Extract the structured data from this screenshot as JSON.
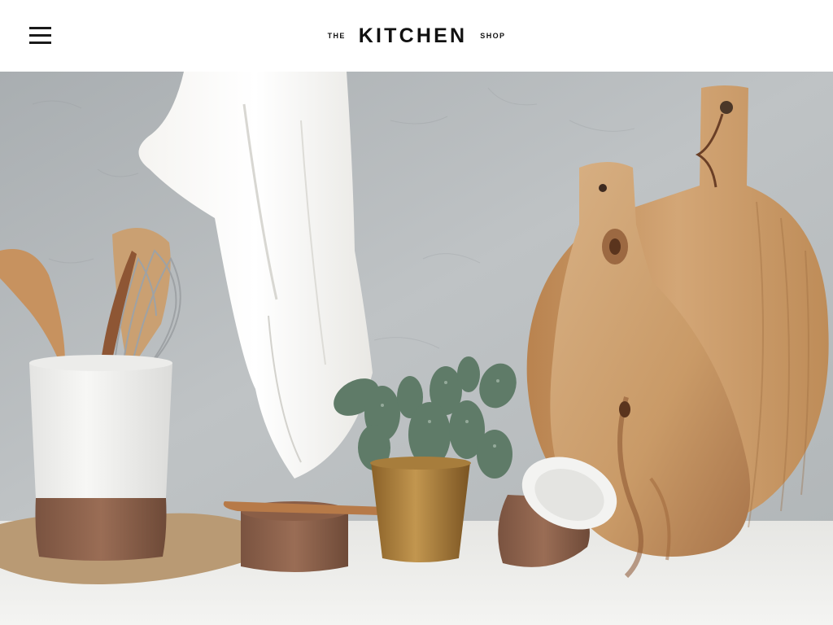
{
  "header": {
    "logo": {
      "prefix": "THE",
      "name": "KITCHEN",
      "suffix": "SHOP"
    },
    "menu_icon": "hamburger-menu-icon"
  },
  "hero": {
    "image": "kitchen-still-life"
  },
  "colors": {
    "header_bg": "#ffffff",
    "text": "#111111",
    "wall": "#b7bcbe",
    "counter": "#f1f1ef"
  }
}
